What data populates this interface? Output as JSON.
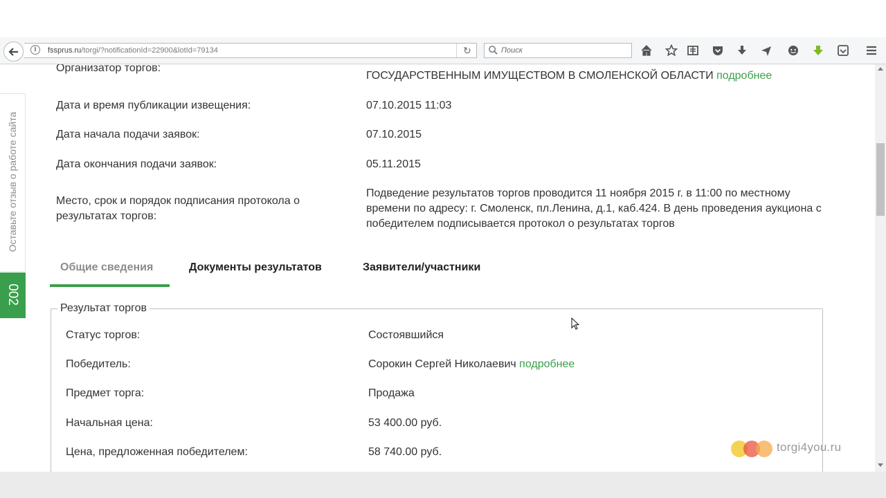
{
  "browser": {
    "url_host": "fssprus.ru",
    "url_path": "/torgi/?notificationId=22900&lotId=79134",
    "search_placeholder": "Поиск"
  },
  "feedback": {
    "label": "Оставьте отзыв о работе сайта",
    "counter": "002"
  },
  "notice": {
    "organizer_label": "Организатор торгов:",
    "organizer_value": "ГОСУДАРСТВЕННЫМ ИМУЩЕСТВОМ В СМОЛЕНСКОЙ ОБЛАСТИ",
    "organizer_link": "подробнее",
    "publication_label": "Дата и время публикации извещения:",
    "publication_value": "07.10.2015 11:03",
    "start_label": "Дата начала подачи заявок:",
    "start_value": "07.10.2015",
    "end_label": "Дата окончания подачи заявок:",
    "end_value": "05.11.2015",
    "protocol_label": "Место, срок и порядок подписания протокола о результатах торгов:",
    "protocol_value": "Подведение результатов торгов проводится 11 ноября 2015 г. в 11:00 по местному времени по адресу: г. Смоленск, пл.Ленина, д.1, каб.424. В день проведения аукциона с победителем подписывается протокол о результатах торгов"
  },
  "tabs": [
    {
      "label": "Общие сведения",
      "active": true
    },
    {
      "label": "Документы результатов",
      "active": false
    },
    {
      "label": "Заявители/участники",
      "active": false
    }
  ],
  "result": {
    "legend": "Результат торгов",
    "rows": [
      {
        "label": "Статус торгов:",
        "value": "Состоявшийся"
      },
      {
        "label": "Победитель:",
        "value": "Сорокин Сергей Николаевич",
        "link": "подробнее"
      },
      {
        "label": "Предмет торга:",
        "value": "Продажа"
      },
      {
        "label": "Начальная цена:",
        "value": "53 400.00 руб."
      },
      {
        "label": "Цена, предложенная победителем:",
        "value": "58 740.00 руб."
      }
    ]
  },
  "watermark": {
    "text": "torgi4you.ru",
    "colors": [
      "#f0c419",
      "#e8533f",
      "#f7a84a"
    ]
  },
  "colors": {
    "accent_green": "#3c9f4a",
    "counter_green": "#3a9f4c"
  }
}
